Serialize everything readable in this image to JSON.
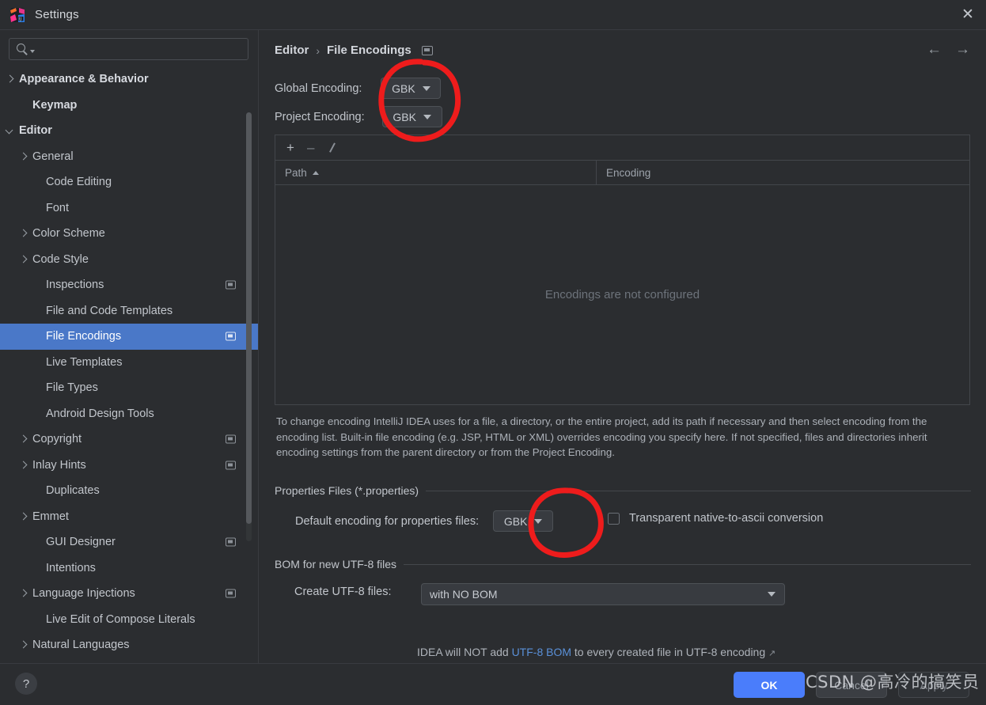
{
  "window": {
    "title": "Settings",
    "close_icon": "close-icon",
    "app_icon": "intellij-idea-logo"
  },
  "sidebar": {
    "search": {
      "placeholder": "",
      "value": "",
      "icon": "search-icon"
    },
    "items": [
      {
        "label": "Appearance & Behavior",
        "indent": 0,
        "arrow": "collapsed",
        "bold": true,
        "badge": false,
        "selected": false
      },
      {
        "label": "Keymap",
        "indent": 1,
        "arrow": "none",
        "bold": true,
        "badge": false,
        "selected": false
      },
      {
        "label": "Editor",
        "indent": 0,
        "arrow": "expanded",
        "bold": true,
        "badge": false,
        "selected": false
      },
      {
        "label": "General",
        "indent": 1,
        "arrow": "collapsed",
        "bold": false,
        "badge": false,
        "selected": false
      },
      {
        "label": "Code Editing",
        "indent": 2,
        "arrow": "none",
        "bold": false,
        "badge": false,
        "selected": false
      },
      {
        "label": "Font",
        "indent": 2,
        "arrow": "none",
        "bold": false,
        "badge": false,
        "selected": false
      },
      {
        "label": "Color Scheme",
        "indent": 1,
        "arrow": "collapsed",
        "bold": false,
        "badge": false,
        "selected": false
      },
      {
        "label": "Code Style",
        "indent": 1,
        "arrow": "collapsed",
        "bold": false,
        "badge": false,
        "selected": false
      },
      {
        "label": "Inspections",
        "indent": 2,
        "arrow": "none",
        "bold": false,
        "badge": true,
        "selected": false
      },
      {
        "label": "File and Code Templates",
        "indent": 2,
        "arrow": "none",
        "bold": false,
        "badge": false,
        "selected": false
      },
      {
        "label": "File Encodings",
        "indent": 2,
        "arrow": "none",
        "bold": false,
        "badge": true,
        "selected": true
      },
      {
        "label": "Live Templates",
        "indent": 2,
        "arrow": "none",
        "bold": false,
        "badge": false,
        "selected": false
      },
      {
        "label": "File Types",
        "indent": 2,
        "arrow": "none",
        "bold": false,
        "badge": false,
        "selected": false
      },
      {
        "label": "Android Design Tools",
        "indent": 2,
        "arrow": "none",
        "bold": false,
        "badge": false,
        "selected": false
      },
      {
        "label": "Copyright",
        "indent": 1,
        "arrow": "collapsed",
        "bold": false,
        "badge": true,
        "selected": false
      },
      {
        "label": "Inlay Hints",
        "indent": 1,
        "arrow": "collapsed",
        "bold": false,
        "badge": true,
        "selected": false
      },
      {
        "label": "Duplicates",
        "indent": 2,
        "arrow": "none",
        "bold": false,
        "badge": false,
        "selected": false
      },
      {
        "label": "Emmet",
        "indent": 1,
        "arrow": "collapsed",
        "bold": false,
        "badge": false,
        "selected": false
      },
      {
        "label": "GUI Designer",
        "indent": 2,
        "arrow": "none",
        "bold": false,
        "badge": true,
        "selected": false
      },
      {
        "label": "Intentions",
        "indent": 2,
        "arrow": "none",
        "bold": false,
        "badge": false,
        "selected": false
      },
      {
        "label": "Language Injections",
        "indent": 1,
        "arrow": "collapsed",
        "bold": false,
        "badge": true,
        "selected": false
      },
      {
        "label": "Live Edit of Compose Literals",
        "indent": 2,
        "arrow": "none",
        "bold": false,
        "badge": false,
        "selected": false
      },
      {
        "label": "Natural Languages",
        "indent": 1,
        "arrow": "collapsed",
        "bold": false,
        "badge": false,
        "selected": false
      }
    ]
  },
  "main": {
    "breadcrumb": {
      "parent": "Editor",
      "separator": "›",
      "current": "File Encodings"
    },
    "nav": {
      "back_icon": "arrow-left-icon",
      "forward_icon": "arrow-right-icon"
    },
    "global_encoding": {
      "label": "Global Encoding:",
      "value": "GBK"
    },
    "project_encoding": {
      "label": "Project Encoding:",
      "value": "GBK"
    },
    "table": {
      "toolbar": {
        "add": "+",
        "remove": "–",
        "edit": "pencil-icon"
      },
      "columns": [
        "Path",
        "Encoding"
      ],
      "sort_column": "Path",
      "sort_direction": "ascending",
      "rows": [],
      "empty_message": "Encodings are not configured"
    },
    "description": "To change encoding IntelliJ IDEA uses for a file, a directory, or the entire project, add its path if necessary and then select encoding from the encoding list. Built-in file encoding (e.g. JSP, HTML or XML) overrides encoding you specify here. If not specified, files and directories inherit encoding settings from the parent directory or from the Project Encoding.",
    "properties_group": {
      "title": "Properties Files (*.properties)",
      "default_encoding_label": "Default encoding for properties files:",
      "default_encoding_value": "GBK",
      "transparent_checkbox_label": "Transparent native-to-ascii conversion",
      "transparent_checked": false
    },
    "bom_group": {
      "title": "BOM for new UTF-8 files",
      "create_label": "Create UTF-8 files:",
      "create_value": "with NO BOM",
      "note_prefix": "IDEA will NOT add ",
      "note_link": "UTF-8 BOM",
      "note_suffix": " to every created file in UTF-8 encoding",
      "external_link_icon": "external-link-icon"
    }
  },
  "footer": {
    "help_label": "?",
    "ok_label": "OK",
    "cancel_label": "Cancel",
    "apply_label": "Apply"
  },
  "watermark": {
    "text": "CSDN @高冷的搞笑员"
  },
  "annotations": {
    "circle_color": "#ee1c1c",
    "marks": [
      {
        "name": "encoding-dropdowns-highlight"
      },
      {
        "name": "properties-encoding-highlight"
      }
    ]
  },
  "colors": {
    "background": "#2b2d30",
    "selection": "#4a78c8",
    "accent_button": "#4a7dfb",
    "link": "#5a90d8",
    "annotation_red": "#ee1c1c"
  }
}
